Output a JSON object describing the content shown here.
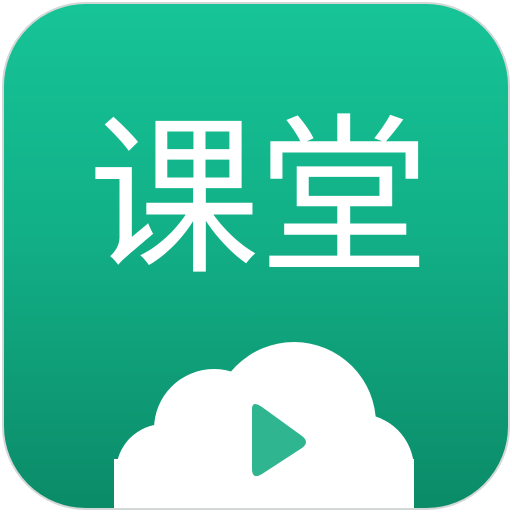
{
  "app_icon": {
    "title": "课堂",
    "colors": {
      "background_top": "#16c497",
      "background_bottom": "#0b8b68",
      "cloud": "#ffffff",
      "play": "#2fb58f"
    },
    "icons": [
      "cloud-icon",
      "play-icon"
    ]
  }
}
